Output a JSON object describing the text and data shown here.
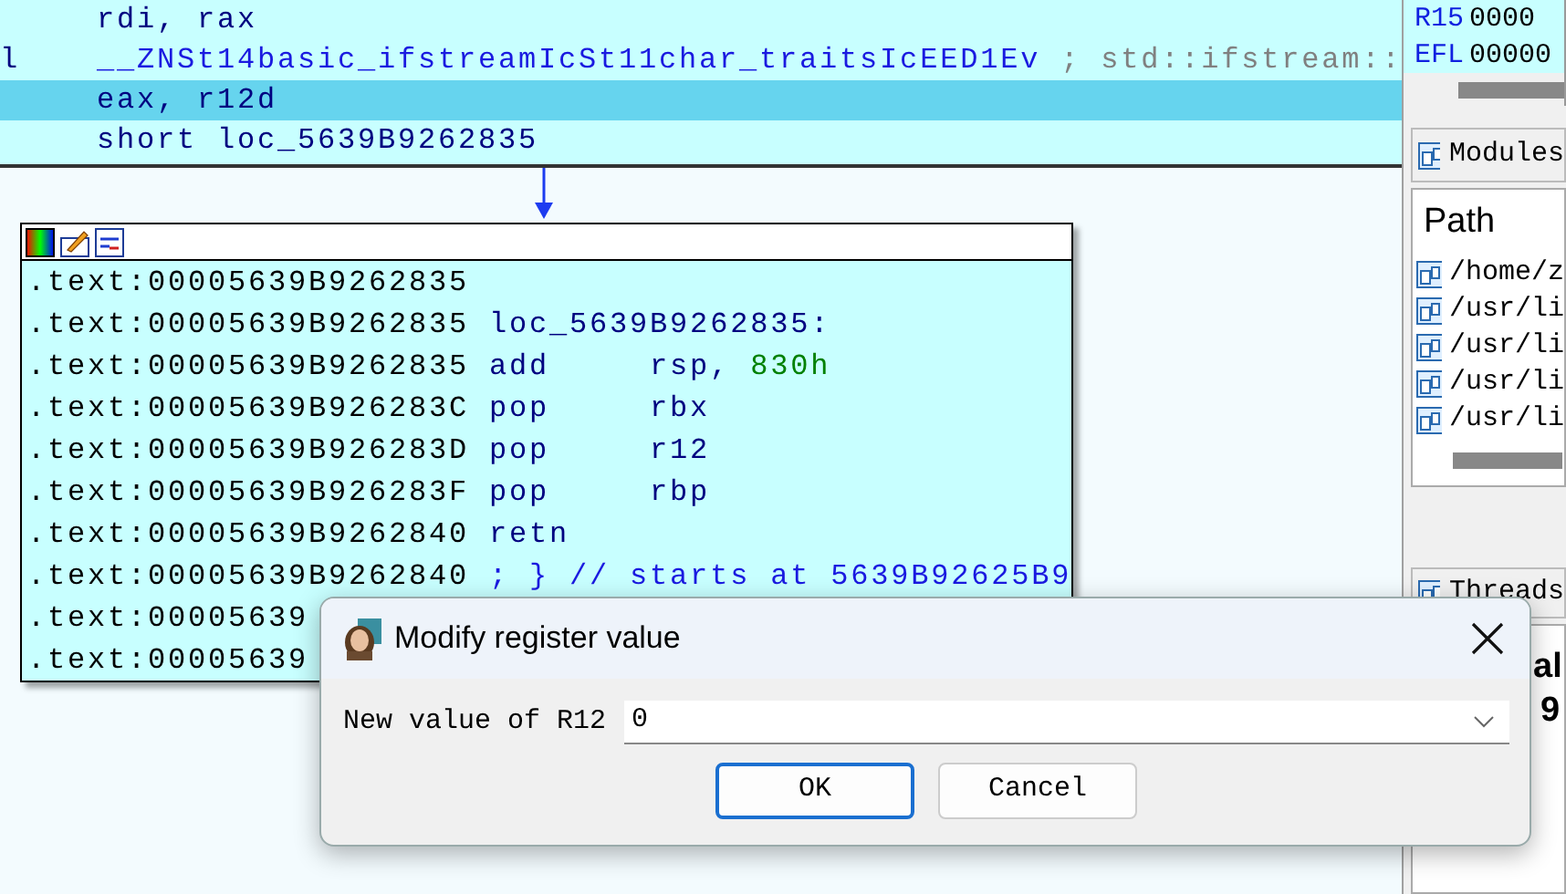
{
  "listing": [
    {
      "operands": "rdi, rax",
      "kind": "plain",
      "selected": false
    },
    {
      "prefix": "l",
      "operands": "__ZNSt14basic_ifstreamIcSt11char_traitsIcEED1Ev",
      "comment": "; std::ifstream::",
      "kind": "call",
      "selected": false
    },
    {
      "operands": "eax, r12d",
      "kind": "plain",
      "selected": true
    },
    {
      "operands": "short loc_5639B9262835",
      "kind": "plain",
      "selected": false
    }
  ],
  "graph_node": {
    "lines": [
      {
        "address": ".text:00005639B9262835",
        "kind": "blank"
      },
      {
        "address": ".text:00005639B9262835",
        "label": "loc_5639B9262835:",
        "kind": "label"
      },
      {
        "address": ".text:00005639B9262835",
        "mnemonic": "add",
        "operand": "rsp,",
        "immediate": "830h",
        "kind": "insn"
      },
      {
        "address": ".text:00005639B926283C",
        "mnemonic": "pop",
        "operand": "rbx",
        "kind": "insn"
      },
      {
        "address": ".text:00005639B926283D",
        "mnemonic": "pop",
        "operand": "r12",
        "kind": "insn"
      },
      {
        "address": ".text:00005639B926283F",
        "mnemonic": "pop",
        "operand": "rbp",
        "kind": "insn"
      },
      {
        "address": ".text:00005639B9262840",
        "mnemonic": "retn",
        "kind": "insn"
      },
      {
        "address": ".text:00005639B9262840",
        "comment": "; } // starts at 5639B92625B9",
        "kind": "comment"
      },
      {
        "address": ".text:00005639",
        "kind": "blank"
      },
      {
        "address": ".text:00005639",
        "kind": "blank"
      }
    ]
  },
  "registers": [
    {
      "name": "R15",
      "value": "0000"
    },
    {
      "name": "EFL",
      "value": "00000"
    }
  ],
  "modules": {
    "title": "Modules",
    "column": "Path",
    "rows": [
      "/home/z",
      "/usr/li",
      "/usr/li",
      "/usr/li",
      "/usr/li"
    ]
  },
  "threads": {
    "title": "Threads",
    "column_1": "al",
    "cell": "9"
  },
  "dialog": {
    "title": "Modify register value",
    "field_label": "New value of R12",
    "value": "0",
    "buttons": [
      {
        "label": "OK",
        "default": true
      },
      {
        "label": "Cancel",
        "default": false
      }
    ]
  }
}
